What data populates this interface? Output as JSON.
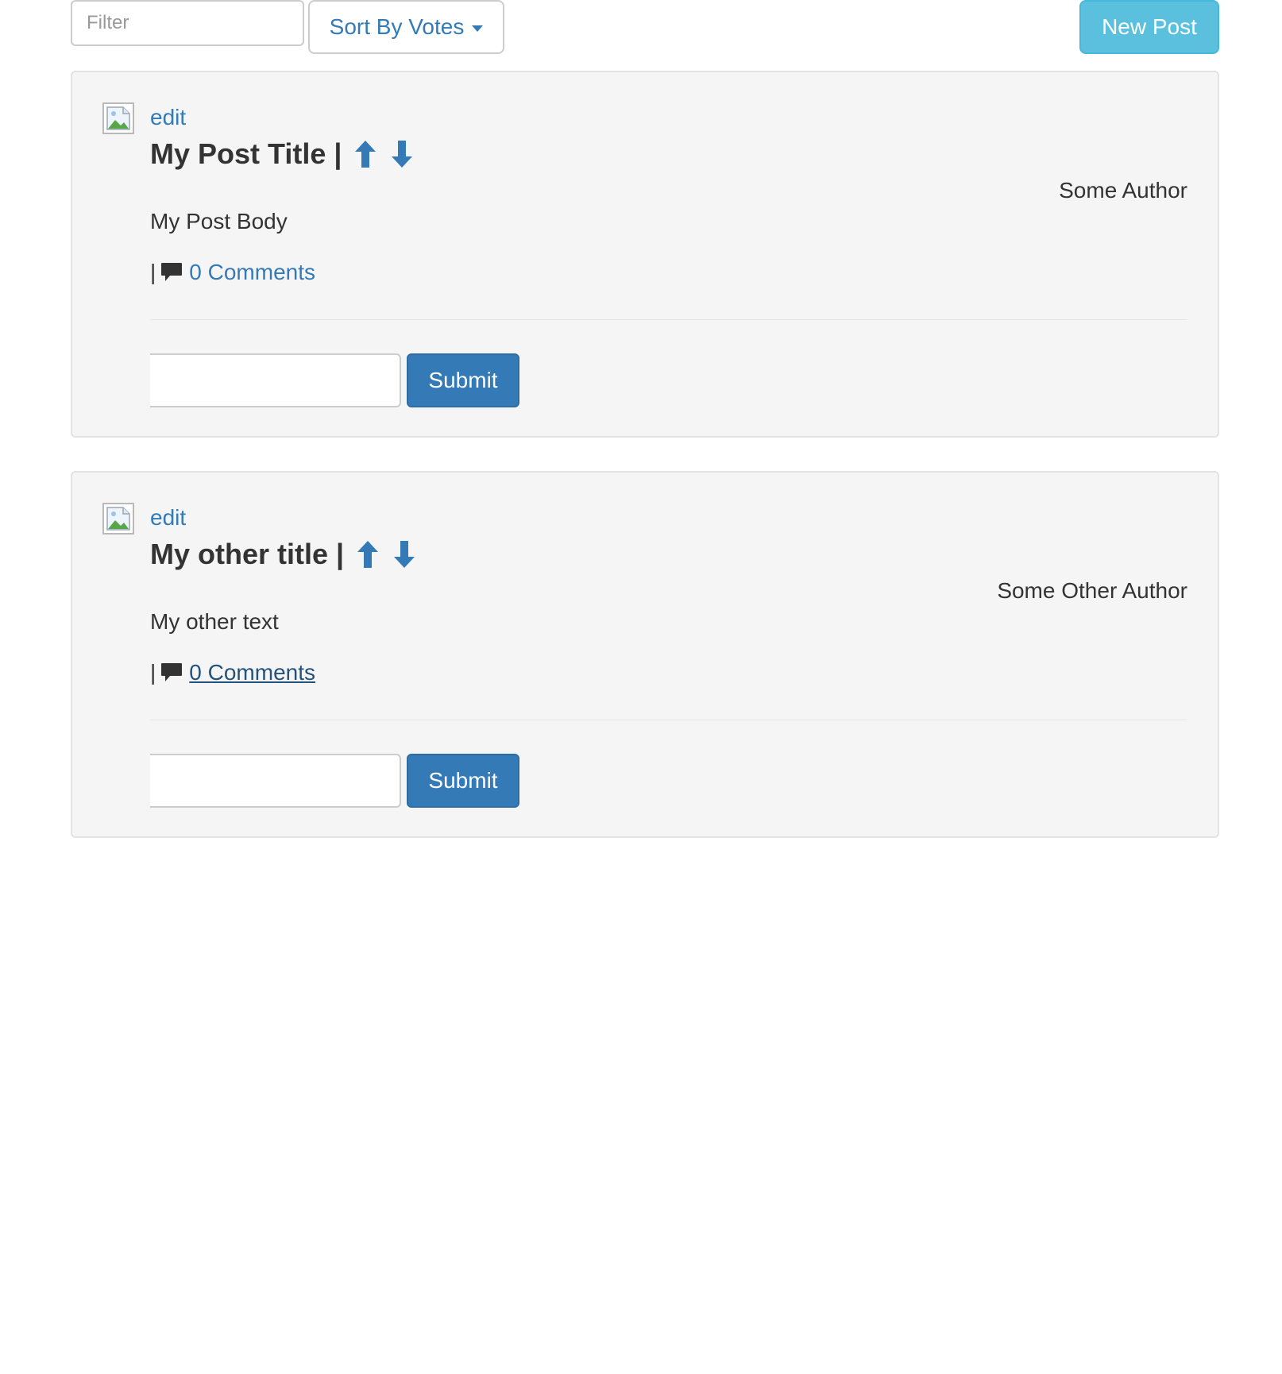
{
  "toolbar": {
    "filter_placeholder": "Filter",
    "filter_value": "",
    "sort_label": "Sort By Votes",
    "new_post_label": "New Post"
  },
  "posts": [
    {
      "edit_label": "edit",
      "title": "My Post Title |",
      "author": "Some Author",
      "body": "My Post Body",
      "comments_separator": "|",
      "comments_label": "0 Comments",
      "comment_input_value": "",
      "submit_label": "Submit"
    },
    {
      "edit_label": "edit",
      "title": "My other title |",
      "author": "Some Other Author",
      "body": "My other text",
      "comments_separator": "|",
      "comments_label": "0 Comments",
      "comment_input_value": "",
      "submit_label": "Submit"
    }
  ],
  "icons": {
    "sort_caret": "caret-down-icon",
    "upvote": "arrow-up-icon",
    "downvote": "arrow-down-icon",
    "comments": "comment-icon",
    "thumbnail": "broken-image-icon"
  },
  "colors": {
    "link": "#337ab7",
    "link_hover": "#23527c",
    "primary_button": "#337ab7",
    "info_button": "#5bc0de",
    "card_background": "#f5f5f5",
    "text": "#333333"
  }
}
